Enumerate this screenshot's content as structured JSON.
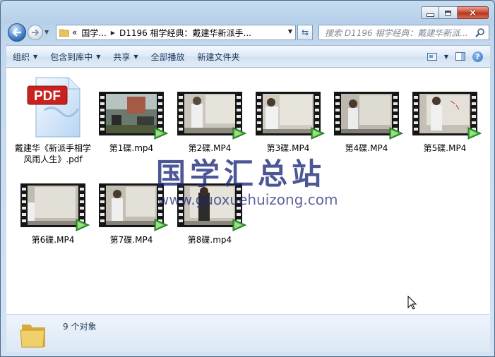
{
  "window": {
    "caption": {
      "minimize_label": "",
      "maximize_label": "",
      "close_label": "×"
    }
  },
  "address": {
    "chevrons": "«",
    "crumbs": [
      "国学...",
      "D1196 相学经典：戴建华新派手..."
    ]
  },
  "search": {
    "placeholder": "搜索 D1196 相学经典：戴建华新派..."
  },
  "toolbar": {
    "organize": "组织",
    "include_in_library": "包含到库中",
    "share": "共享",
    "play_all": "全部播放",
    "new_folder": "新建文件夹"
  },
  "files": [
    {
      "name": "戴建华《新派手相学风雨人生》.pdf",
      "type": "pdf"
    },
    {
      "name": "第1碟.mp4",
      "type": "video"
    },
    {
      "name": "第2碟.MP4",
      "type": "video"
    },
    {
      "name": "第3碟.MP4",
      "type": "video"
    },
    {
      "name": "第4碟.MP4",
      "type": "video"
    },
    {
      "name": "第5碟.MP4",
      "type": "video"
    },
    {
      "name": "第6碟.MP4",
      "type": "video"
    },
    {
      "name": "第7碟.MP4",
      "type": "video"
    },
    {
      "name": "第8碟.mp4",
      "type": "video"
    }
  ],
  "pdf_badge": "PDF",
  "status": {
    "count_text": "9 个对象"
  },
  "watermark": {
    "cn": "国学汇总站",
    "en": "www.guoxuehuizong.com"
  },
  "colors": {
    "accent": "#1e395b",
    "pdf_red": "#c8211f",
    "play_green": "#3aa63a"
  }
}
